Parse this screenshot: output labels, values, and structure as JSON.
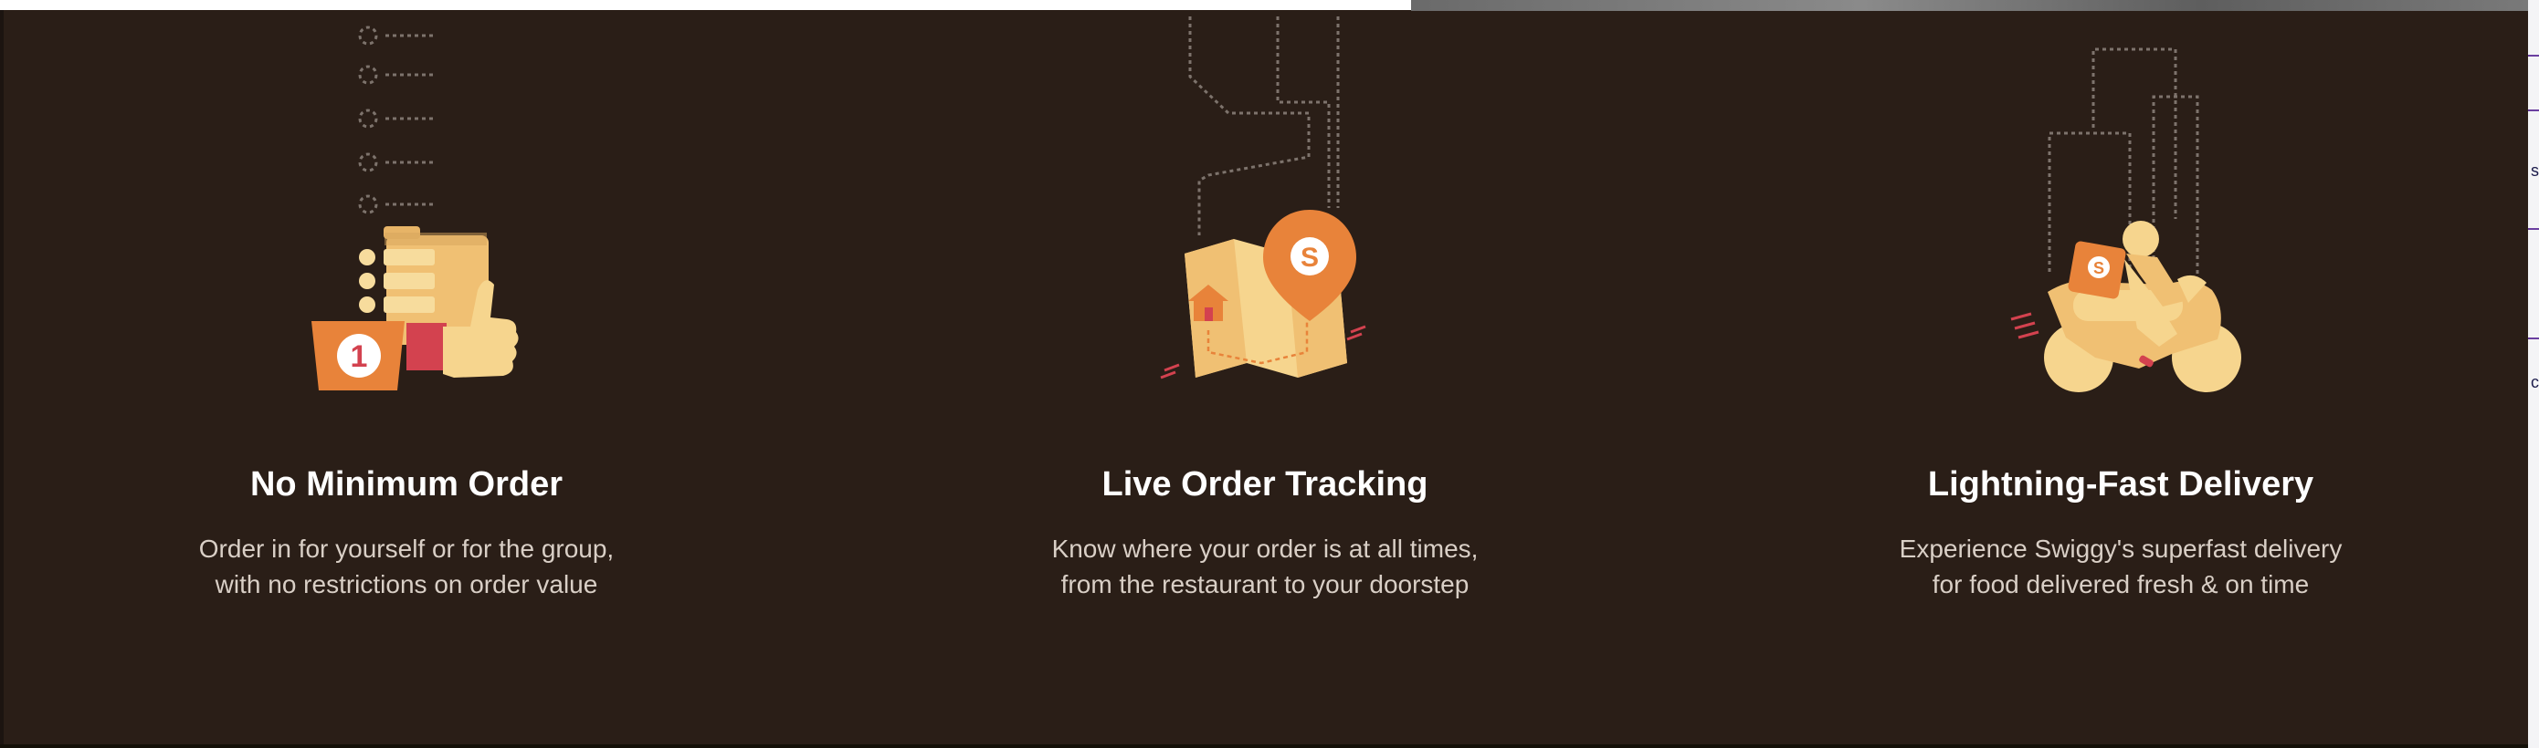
{
  "features": [
    {
      "title": "No Minimum Order",
      "description": "Order in for yourself or for the group, with no restrictions on order value",
      "icon": "order-thumbs-up-icon",
      "badge_number": "1"
    },
    {
      "title": "Live Order Tracking",
      "description": "Know where your order is at all times, from the restaurant to your doorstep",
      "icon": "map-location-pin-icon"
    },
    {
      "title": "Lightning-Fast Delivery",
      "description": "Experience Swiggy's superfast delivery for food delivered fresh & on time",
      "icon": "delivery-scooter-icon"
    }
  ],
  "colors": {
    "background": "#2a1e17",
    "accent_orange": "#e8833a",
    "cream": "#f6d58e",
    "red": "#d3424f",
    "title_text": "#ffffff",
    "desc_text": "#d9cfc6"
  }
}
